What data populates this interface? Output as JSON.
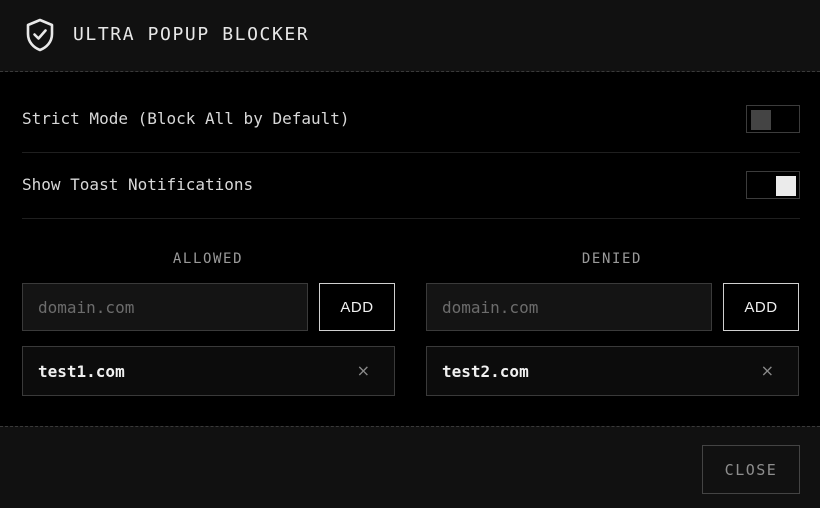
{
  "header": {
    "title": "ULTRA POPUP BLOCKER",
    "icon": "shield-check-icon"
  },
  "settings": [
    {
      "label": "Strict Mode (Block All by Default)",
      "enabled": false
    },
    {
      "label": "Show Toast Notifications",
      "enabled": true
    }
  ],
  "allowed": {
    "title": "ALLOWED",
    "input_placeholder": "domain.com",
    "input_value": "",
    "add_label": "ADD",
    "items": [
      {
        "domain": "test1.com",
        "remove": "×"
      }
    ]
  },
  "denied": {
    "title": "DENIED",
    "input_placeholder": "domain.com",
    "input_value": "",
    "add_label": "ADD",
    "items": [
      {
        "domain": "test2.com",
        "remove": "×"
      }
    ]
  },
  "footer": {
    "close_label": "CLOSE"
  },
  "colors": {
    "background": "#000000",
    "panel": "#111111",
    "toggle_on_knob": "#ebebeb",
    "toggle_off_knob": "#444444"
  }
}
